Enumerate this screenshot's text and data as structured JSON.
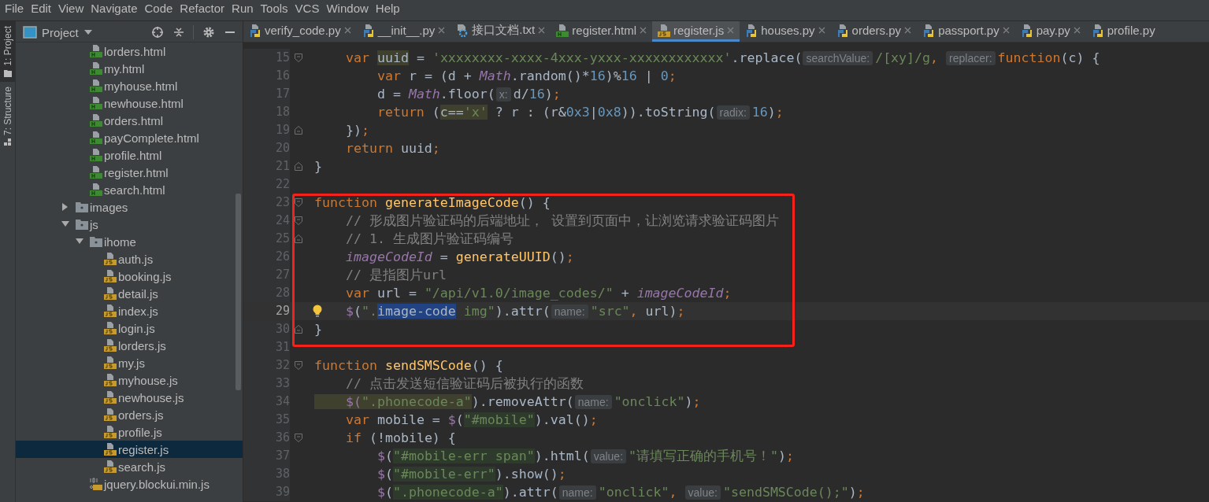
{
  "menu": [
    "File",
    "Edit",
    "View",
    "Navigate",
    "Code",
    "Refactor",
    "Run",
    "Tools",
    "VCS",
    "Window",
    "Help"
  ],
  "tool_strip": [
    {
      "label": "1: Project",
      "kind": "project",
      "selected": true
    },
    {
      "label": "7: Structure",
      "kind": "structure",
      "selected": false
    }
  ],
  "project_panel": {
    "title": "Project",
    "tree": [
      {
        "kind": "group",
        "children": [
          {
            "label": "lorders.html",
            "kind": "html",
            "selected": false
          },
          {
            "label": "my.html",
            "kind": "html",
            "selected": false
          },
          {
            "label": "myhouse.html",
            "kind": "html",
            "selected": false
          },
          {
            "label": "newhouse.html",
            "kind": "html",
            "selected": false
          },
          {
            "label": "orders.html",
            "kind": "html",
            "selected": false
          },
          {
            "label": "payComplete.html",
            "kind": "html",
            "selected": false
          },
          {
            "label": "profile.html",
            "kind": "html",
            "selected": false
          },
          {
            "label": "register.html",
            "kind": "html",
            "selected": false
          },
          {
            "label": "search.html",
            "kind": "html",
            "selected": false
          }
        ]
      },
      {
        "label": "images",
        "kind": "folder",
        "expanded": false,
        "selected": false
      },
      {
        "label": "js",
        "kind": "folder",
        "expanded": true,
        "selected": false,
        "children": [
          {
            "label": "ihome",
            "kind": "folder",
            "expanded": true,
            "selected": false,
            "children": [
              {
                "label": "auth.js",
                "kind": "js",
                "selected": false
              },
              {
                "label": "booking.js",
                "kind": "js",
                "selected": false
              },
              {
                "label": "detail.js",
                "kind": "js",
                "selected": false
              },
              {
                "label": "index.js",
                "kind": "js",
                "selected": false
              },
              {
                "label": "login.js",
                "kind": "js",
                "selected": false
              },
              {
                "label": "lorders.js",
                "kind": "js",
                "selected": false
              },
              {
                "label": "my.js",
                "kind": "js",
                "selected": false
              },
              {
                "label": "myhouse.js",
                "kind": "js",
                "selected": false
              },
              {
                "label": "newhouse.js",
                "kind": "js",
                "selected": false
              },
              {
                "label": "orders.js",
                "kind": "js",
                "selected": false
              },
              {
                "label": "profile.js",
                "kind": "js",
                "selected": false
              },
              {
                "label": "register.js",
                "kind": "js",
                "selected": true
              },
              {
                "label": "search.js",
                "kind": "js",
                "selected": false
              }
            ]
          },
          {
            "label": "jquery.blockui.min.js",
            "kind": "min-js",
            "selected": false
          }
        ]
      }
    ]
  },
  "tabs": [
    {
      "label": "verify_code.py",
      "kind": "py",
      "selected": false,
      "closable": true
    },
    {
      "label": "__init__.py",
      "kind": "py",
      "selected": false,
      "closable": true
    },
    {
      "label": "接口文档.txt",
      "kind": "txt",
      "selected": false,
      "closable": true
    },
    {
      "label": "register.html",
      "kind": "html",
      "selected": false,
      "closable": true
    },
    {
      "label": "register.js",
      "kind": "js",
      "selected": true,
      "closable": true
    },
    {
      "label": "houses.py",
      "kind": "py",
      "selected": false,
      "closable": true
    },
    {
      "label": "orders.py",
      "kind": "py",
      "selected": false,
      "closable": true
    },
    {
      "label": "passport.py",
      "kind": "py",
      "selected": false,
      "closable": true
    },
    {
      "label": "pay.py",
      "kind": "py",
      "selected": false,
      "closable": true
    },
    {
      "label": "profile.py",
      "kind": "py",
      "selected": false,
      "closable": false
    }
  ],
  "editor": {
    "blocks": [
      {
        "kind": "plain",
        "lines": [
          {
            "number": "15",
            "current": false,
            "markers": [
              {
                "kind": "fold-start"
              }
            ],
            "tokens": [
              {
                "text": "    var ",
                "kind": "kw"
              },
              {
                "text": "uuid",
                "kind": "plain-usage"
              },
              {
                "text": " = ",
                "kind": "plain"
              },
              {
                "text": "'xxxxxxxx-xxxx-4xxx-yxxx-xxxxxxxxxxxx'",
                "kind": "str"
              },
              {
                "text": ".replace(",
                "kind": "plain"
              },
              {
                "text": "searchValue:",
                "kind": "hint"
              },
              {
                "text": "/[xy]/g",
                "kind": "str"
              },
              {
                "text": ",",
                "kind": "punct"
              },
              {
                "text": "replacer:",
                "kind": "hint"
              },
              {
                "text": "function",
                "kind": "kw"
              },
              {
                "text": "(c) {",
                "kind": "plain"
              }
            ]
          },
          {
            "number": "16",
            "current": false,
            "tokens": [
              {
                "text": "        var",
                "kind": "kw"
              },
              {
                "text": " r = (d + ",
                "kind": "plain"
              },
              {
                "text": "Math",
                "kind": "field"
              },
              {
                "text": ".random()*",
                "kind": "plain"
              },
              {
                "text": "16",
                "kind": "num"
              },
              {
                "text": ")%",
                "kind": "plain"
              },
              {
                "text": "16",
                "kind": "num"
              },
              {
                "text": " | ",
                "kind": "plain"
              },
              {
                "text": "0",
                "kind": "num"
              },
              {
                "text": ";",
                "kind": "punct"
              }
            ]
          },
          {
            "number": "17",
            "current": false,
            "tokens": [
              {
                "text": "        d = ",
                "kind": "plain"
              },
              {
                "text": "Math",
                "kind": "field"
              },
              {
                "text": ".floor(",
                "kind": "plain"
              },
              {
                "text": "x:",
                "kind": "hint"
              },
              {
                "text": "d/",
                "kind": "plain"
              },
              {
                "text": "16",
                "kind": "num"
              },
              {
                "text": ")",
                "kind": "plain"
              },
              {
                "text": ";",
                "kind": "punct"
              }
            ]
          },
          {
            "number": "18",
            "current": false,
            "tokens": [
              {
                "text": "        return",
                "kind": "kw"
              },
              {
                "text": " (",
                "kind": "plain"
              },
              {
                "text": "c==",
                "kind": "plain-usage"
              },
              {
                "text": "'x'",
                "kind": "str-usage"
              },
              {
                "text": " ? r : (r&",
                "kind": "plain"
              },
              {
                "text": "0x3",
                "kind": "num"
              },
              {
                "text": "|",
                "kind": "plain"
              },
              {
                "text": "0x8",
                "kind": "num"
              },
              {
                "text": ")).toString(",
                "kind": "plain"
              },
              {
                "text": "radix:",
                "kind": "hint"
              },
              {
                "text": "16",
                "kind": "num"
              },
              {
                "text": ")",
                "kind": "plain"
              },
              {
                "text": ";",
                "kind": "punct"
              }
            ]
          },
          {
            "number": "19",
            "current": false,
            "markers": [
              {
                "kind": "fold-end"
              }
            ],
            "tokens": [
              {
                "text": "    })",
                "kind": "plain"
              },
              {
                "text": ";",
                "kind": "punct"
              }
            ]
          },
          {
            "number": "20",
            "current": false,
            "tokens": [
              {
                "text": "    return",
                "kind": "kw"
              },
              {
                "text": " uuid",
                "kind": "plain"
              },
              {
                "text": ";",
                "kind": "punct"
              }
            ]
          },
          {
            "number": "21",
            "current": false,
            "markers": [
              {
                "kind": "fold-end"
              }
            ],
            "tokens": [
              {
                "text": "}",
                "kind": "plain"
              }
            ]
          },
          {
            "number": "22",
            "current": false
          }
        ]
      },
      {
        "kind": "framed",
        "lines": [
          {
            "number": "23",
            "current": false,
            "markers": [
              {
                "kind": "fold-start"
              }
            ],
            "tokens": [
              {
                "text": "function ",
                "kind": "kw"
              },
              {
                "text": "generateImageCode",
                "kind": "fn"
              },
              {
                "text": "() {",
                "kind": "plain"
              }
            ]
          },
          {
            "number": "24",
            "current": false,
            "markers": [
              {
                "kind": "fold-start"
              }
            ],
            "tokens": [
              {
                "text": "    // 形成图片验证码的后端地址， 设置到页面中，让浏览请求验证码图片",
                "kind": "cmt"
              }
            ]
          },
          {
            "number": "25",
            "current": false,
            "markers": [
              {
                "kind": "fold-end"
              }
            ],
            "tokens": [
              {
                "text": "    // 1. 生成图片验证码编号",
                "kind": "cmt"
              }
            ]
          },
          {
            "number": "26",
            "current": false,
            "tokens": [
              {
                "text": "    imageCodeId",
                "kind": "field"
              },
              {
                "text": " = ",
                "kind": "plain"
              },
              {
                "text": "generateUUID",
                "kind": "fn"
              },
              {
                "text": "()",
                "kind": "plain"
              },
              {
                "text": ";",
                "kind": "punct"
              }
            ]
          },
          {
            "number": "27",
            "current": false,
            "tokens": [
              {
                "text": "    // 是指图片url",
                "kind": "cmt"
              }
            ]
          },
          {
            "number": "28",
            "current": false,
            "tokens": [
              {
                "text": "    var",
                "kind": "kw"
              },
              {
                "text": " url = ",
                "kind": "plain"
              },
              {
                "text": "\"/api/v1.0/image_codes/\"",
                "kind": "str"
              },
              {
                "text": " + ",
                "kind": "plain"
              },
              {
                "text": "imageCodeId",
                "kind": "field"
              },
              {
                "text": ";",
                "kind": "punct"
              }
            ]
          },
          {
            "number": "29",
            "current": true,
            "markers": [
              {
                "kind": "bulb"
              }
            ],
            "tokens": [
              {
                "text": "    $",
                "kind": "global"
              },
              {
                "text": "(",
                "kind": "plain"
              },
              {
                "text": "\".",
                "kind": "str"
              },
              {
                "text": "image-code",
                "kind": "plain-selection"
              },
              {
                "text": " img\"",
                "kind": "str"
              },
              {
                "text": ").attr(",
                "kind": "plain"
              },
              {
                "text": "name:",
                "kind": "hint"
              },
              {
                "text": "\"src\"",
                "kind": "str"
              },
              {
                "text": ",",
                "kind": "punct"
              },
              {
                "text": " url)",
                "kind": "plain"
              },
              {
                "text": ";",
                "kind": "punct"
              }
            ]
          },
          {
            "number": "30",
            "current": false,
            "markers": [
              {
                "kind": "fold-end"
              }
            ],
            "tokens": [
              {
                "text": "}",
                "kind": "plain"
              }
            ]
          }
        ]
      },
      {
        "kind": "plain",
        "lines": [
          {
            "number": "31",
            "current": false
          },
          {
            "number": "32",
            "current": false,
            "markers": [
              {
                "kind": "fold-start"
              }
            ],
            "tokens": [
              {
                "text": "function ",
                "kind": "kw"
              },
              {
                "text": "sendSMSCode",
                "kind": "fn"
              },
              {
                "text": "() {",
                "kind": "plain"
              }
            ]
          },
          {
            "number": "33",
            "current": false,
            "tokens": [
              {
                "text": "    // 点击发送短信验证码后被执行的函数",
                "kind": "cmt"
              }
            ]
          },
          {
            "number": "34",
            "current": false,
            "tokens": [
              {
                "text": "    $(",
                "kind": "global-usage"
              },
              {
                "text": "\".phonecode-a\"",
                "kind": "str-usage"
              },
              {
                "text": ").removeAttr(",
                "kind": "plain"
              },
              {
                "text": "name:",
                "kind": "hint"
              },
              {
                "text": "\"onclick\"",
                "kind": "str"
              },
              {
                "text": ")",
                "kind": "plain"
              },
              {
                "text": ";",
                "kind": "punct"
              }
            ]
          },
          {
            "number": "35",
            "current": false,
            "tokens": [
              {
                "text": "    var",
                "kind": "kw"
              },
              {
                "text": " mobile = ",
                "kind": "plain"
              },
              {
                "text": "$",
                "kind": "global"
              },
              {
                "text": "(",
                "kind": "plain"
              },
              {
                "text": "\"#mobile\"",
                "kind": "str-inject"
              },
              {
                "text": ").val()",
                "kind": "plain"
              },
              {
                "text": ";",
                "kind": "punct"
              }
            ]
          },
          {
            "number": "36",
            "current": false,
            "markers": [
              {
                "kind": "fold-start"
              }
            ],
            "tokens": [
              {
                "text": "    if",
                "kind": "kw"
              },
              {
                "text": " (!mobile) {",
                "kind": "plain"
              }
            ]
          },
          {
            "number": "37",
            "current": false,
            "tokens": [
              {
                "text": "        $",
                "kind": "global"
              },
              {
                "text": "(",
                "kind": "plain"
              },
              {
                "text": "\"#mobile-err span\"",
                "kind": "str-inject"
              },
              {
                "text": ").html(",
                "kind": "plain"
              },
              {
                "text": "value:",
                "kind": "hint"
              },
              {
                "text": "\"请填写正确的手机号！\"",
                "kind": "str"
              },
              {
                "text": ")",
                "kind": "plain"
              },
              {
                "text": ";",
                "kind": "punct"
              }
            ]
          },
          {
            "number": "38",
            "current": false,
            "tokens": [
              {
                "text": "        $",
                "kind": "global"
              },
              {
                "text": "(",
                "kind": "plain"
              },
              {
                "text": "\"#mobile-err\"",
                "kind": "str-inject"
              },
              {
                "text": ").show()",
                "kind": "plain"
              },
              {
                "text": ";",
                "kind": "punct"
              }
            ]
          },
          {
            "number": "39",
            "current": false,
            "tokens": [
              {
                "text": "        $",
                "kind": "global"
              },
              {
                "text": "(",
                "kind": "plain"
              },
              {
                "text": "\".phonecode-a\"",
                "kind": "str-inject"
              },
              {
                "text": ").attr(",
                "kind": "plain"
              },
              {
                "text": "name:",
                "kind": "hint"
              },
              {
                "text": "\"onclick\"",
                "kind": "str"
              },
              {
                "text": ",",
                "kind": "punct"
              },
              {
                "text": "value:",
                "kind": "hint"
              },
              {
                "text": "\"sendSMSCode();\"",
                "kind": "str"
              },
              {
                "text": ")",
                "kind": "plain"
              },
              {
                "text": ";",
                "kind": "punct"
              }
            ]
          }
        ]
      }
    ]
  }
}
